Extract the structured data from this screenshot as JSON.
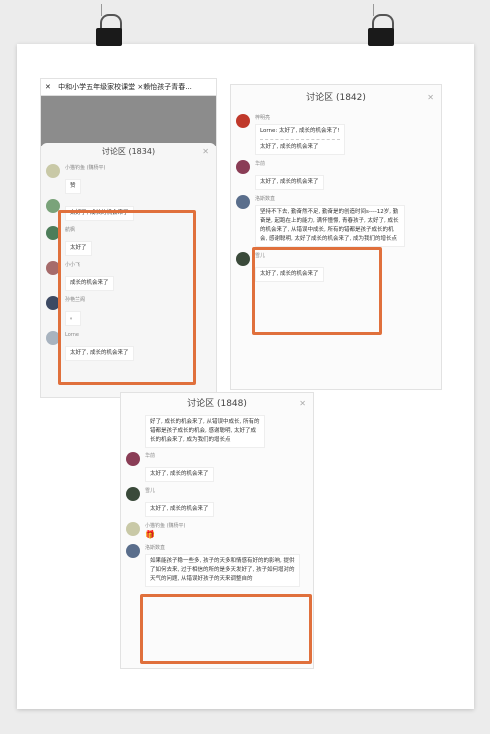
{
  "screenshot1": {
    "header_title": "中和小学五年级家校课堂 ×赖怡孩子青春...",
    "panel_title": "讨论区 (1834)",
    "messages": [
      {
        "name": "小猫钓鱼 (魏杨平)",
        "text": "赞",
        "color": "#c9c9a7"
      },
      {
        "name": "",
        "text": "太好了, 成长的机会来了",
        "color": "#7aa37a"
      },
      {
        "name": "航枫",
        "text": "太好了",
        "color": "#4d7d5a"
      },
      {
        "name": "小小飞",
        "text": "成长的机会来了",
        "color": "#a66b6b"
      },
      {
        "name": "孙艳兰阁",
        "text": "。",
        "color": "#3d4a63"
      },
      {
        "name": "Lorne",
        "text": "太好了, 成长的机会来了",
        "color": "#a8b3bf"
      }
    ]
  },
  "screenshot2": {
    "panel_title": "讨论区 (1842)",
    "messages": [
      {
        "name": "梓明亮",
        "text": "Lorne: 太好了, 成长的机会来了!",
        "reply": "太好了, 成长的机会来了",
        "color": "#c0392b"
      },
      {
        "name": "华前",
        "text": "太好了, 成长的机会来了",
        "color": "#8a3d56"
      },
      {
        "name": "洛斯数直",
        "text": "坚持不下去, 勤奋然不足, 勤奋是的创造时间s----12岁, 勤奋是, 起跑在上的能力, 满怀憧憬, 青春孩子, 太好了, 成长的机会来了, 从错误中成长, 所有的错都是孩子成长的机会, 感谢聪明, 太好了成长的机会来了, 成为我们的增长点",
        "color": "#5a6e8c"
      },
      {
        "name": "雪儿",
        "text": "太好了, 成长的机会来了",
        "color": "#3a4a3a"
      }
    ]
  },
  "screenshot3": {
    "panel_title": "讨论区 (1848)",
    "top_text": "好了, 成长的机会来了, 从错误中成长, 所有的错都是孩子成长的机会, 感谢聪明, 太好了成长的机会来了, 成为我们的增长点",
    "messages": [
      {
        "name": "华前",
        "text": "太好了, 成长的机会来了",
        "color": "#8a3d56"
      },
      {
        "name": "雪儿",
        "text": "太好了, 成长的机会来了",
        "color": "#3a4a3a"
      },
      {
        "name": "小猫钓鱼 (魏杨平)",
        "text": "🎁",
        "color": "#c9c9a7"
      },
      {
        "name": "洛斯数直",
        "text": "如果能孩子稳一些多, 孩子的天多和情感有好的的影响, 提供了如何去来, 过于相信的所的是多天发好了, 孩子如何增对的天气的问题, 从错误好孩子的天来调整自的",
        "color": "#5a6e8c"
      }
    ]
  }
}
